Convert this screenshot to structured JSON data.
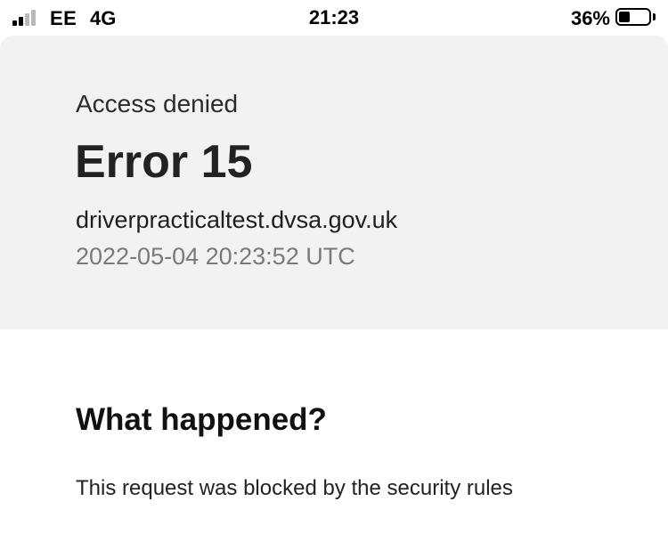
{
  "status_bar": {
    "carrier": "EE",
    "network": "4G",
    "time": "21:23",
    "battery_percent": "36%",
    "battery_level": 0.36,
    "signal_bars": 2,
    "signal_total": 4
  },
  "error": {
    "title": "Access denied",
    "code": "Error 15",
    "domain": "driverpracticaltest.dvsa.gov.uk",
    "timestamp": "2022-05-04 20:23:52 UTC"
  },
  "details": {
    "heading": "What happened?",
    "body": "This request was blocked by the security rules"
  },
  "colors": {
    "panel_background": "#f2f2f2",
    "timestamp_text": "#7a7a7a"
  }
}
